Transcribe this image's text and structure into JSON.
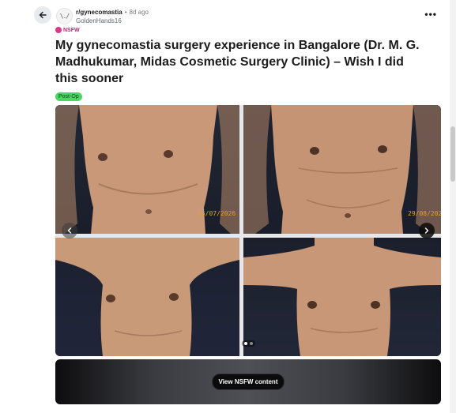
{
  "post": {
    "subreddit": "r/gynecomastia",
    "separator": "•",
    "time_ago": "8d ago",
    "author": "GoldenHands16",
    "avatar_text": "\\./",
    "nsfw_label": "NSFW",
    "title": "My gynecomastia surgery experience in Bangalore (Dr. M. G. Madhukumar, Midas Cosmetic Surgery Clinic) – Wish I did this sooner",
    "flair": "Post-Op",
    "more_label": "•••"
  },
  "gallery": {
    "dates": [
      "15/07/2026",
      "29/08/2026"
    ],
    "page_current": 1,
    "page_count": 2
  },
  "nsfw_gate": {
    "button_label": "View NSFW content"
  },
  "colors": {
    "nsfw": "#c22074",
    "flair_bg": "#4dd664",
    "skin": "#c99a78",
    "date_stamp": "#e8a020"
  },
  "icons": {
    "back": "arrow-left-icon",
    "prev": "chevron-left-icon",
    "next": "chevron-right-icon",
    "more": "more-horizontal-icon",
    "nsfw": "nsfw-badge-icon"
  }
}
